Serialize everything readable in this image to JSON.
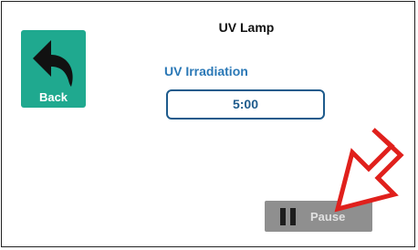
{
  "screen": {
    "title": "UV Lamp"
  },
  "back_button": {
    "label": "Back",
    "icon": "back-arrow-icon",
    "color": "#1fa98f"
  },
  "uv_irradiation": {
    "label": "UV Irradiation",
    "value": "5:00"
  },
  "pause_button": {
    "label": "Pause",
    "icon": "pause-icon",
    "color": "#8f8f8f"
  },
  "annotation": {
    "icon": "red-pointer-arrow",
    "color": "#e0201c"
  }
}
